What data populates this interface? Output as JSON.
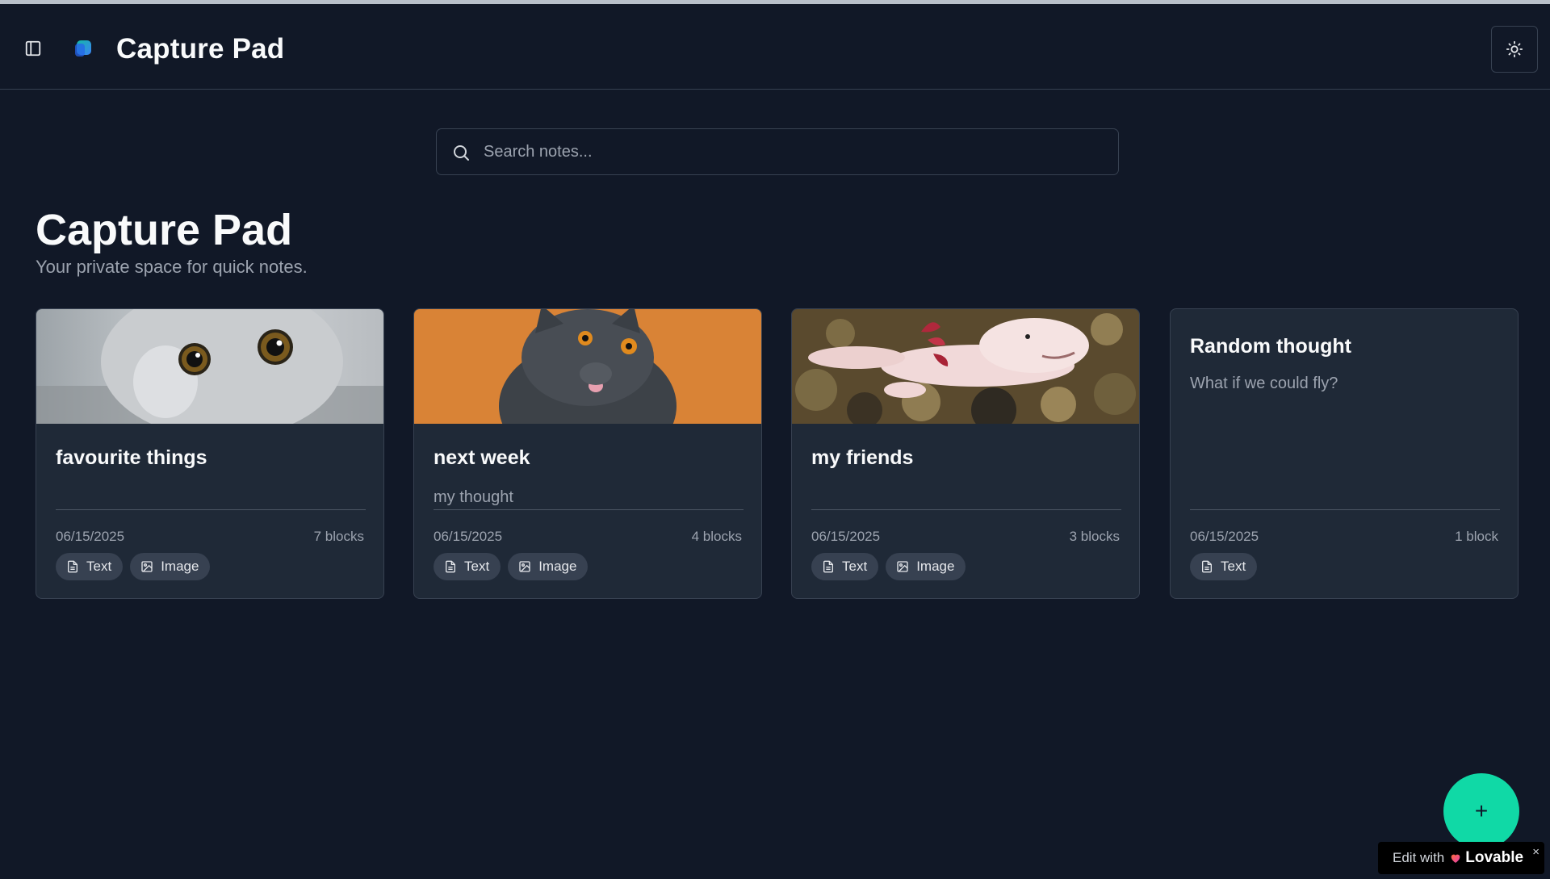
{
  "header": {
    "app_title": "Capture Pad",
    "sidebar_toggle_icon": "panel-left-icon",
    "logo_icon": "app-logo",
    "theme_toggle_icon": "sun-icon"
  },
  "search": {
    "placeholder": "Search notes...",
    "value": ""
  },
  "page": {
    "title": "Capture Pad",
    "subtitle": "Your private space for quick notes."
  },
  "notes": [
    {
      "title": "favourite things",
      "preview": "",
      "date": "06/15/2025",
      "blocks": "7 blocks",
      "image": "grey-cat-photo",
      "tags": [
        {
          "label": "Text",
          "icon": "file-text-icon"
        },
        {
          "label": "Image",
          "icon": "image-icon"
        }
      ]
    },
    {
      "title": "next week",
      "preview": "my thought",
      "date": "06/15/2025",
      "blocks": "4 blocks",
      "image": "british-shorthair-cat-photo",
      "tags": [
        {
          "label": "Text",
          "icon": "file-text-icon"
        },
        {
          "label": "Image",
          "icon": "image-icon"
        }
      ]
    },
    {
      "title": "my friends",
      "preview": "",
      "date": "06/15/2025",
      "blocks": "3 blocks",
      "image": "axolotl-photo",
      "tags": [
        {
          "label": "Text",
          "icon": "file-text-icon"
        },
        {
          "label": "Image",
          "icon": "image-icon"
        }
      ]
    },
    {
      "title": "Random thought",
      "preview": "What if we could fly?",
      "date": "06/15/2025",
      "blocks": "1 block",
      "image": "",
      "tags": [
        {
          "label": "Text",
          "icon": "file-text-icon"
        }
      ]
    }
  ],
  "fab": {
    "label": "+"
  },
  "badge": {
    "prefix": "Edit with",
    "brand": "Lovable",
    "close": "×"
  },
  "colors": {
    "background": "#111827",
    "card": "#1f2937",
    "accent": "#10d9a6"
  }
}
